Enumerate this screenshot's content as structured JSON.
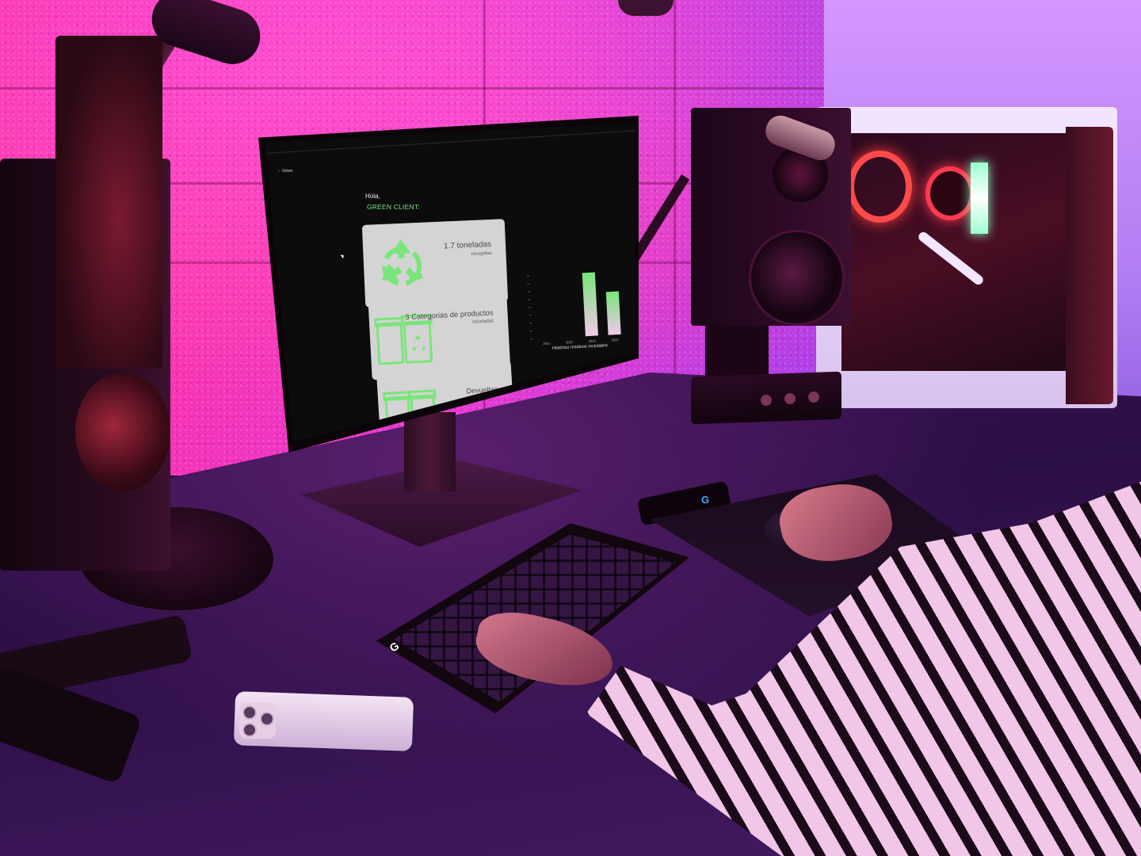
{
  "screen": {
    "back_link": "Volver",
    "greeting": "Hola,",
    "client_name": "GREEN CLIENT:",
    "cards": [
      {
        "value": "1.7 toneladas",
        "sub": "recogidas",
        "icon": "recycle-icon"
      },
      {
        "value": "3 Categorias de productos",
        "sub": "reciclados",
        "icon": "recycle-bin-icon"
      },
      {
        "value": "Devueltas",
        "sub": "",
        "icon": "bins-icon"
      }
    ],
    "chart_title": "Histórico residuos reciclados"
  },
  "chart_data": {
    "type": "bar",
    "categories": [
      "2021",
      "2022",
      "2023",
      "2024"
    ],
    "values": [
      0,
      0,
      100,
      68
    ],
    "title": "Histórico residuos reciclados",
    "xlabel": "",
    "ylabel": "",
    "colors": [
      "#79e57a",
      "#f2c8ec"
    ]
  },
  "colors": {
    "accent_green": "#79e57a",
    "card_bg": "#d4d4d4",
    "screen_bg": "#0c0c0c"
  }
}
